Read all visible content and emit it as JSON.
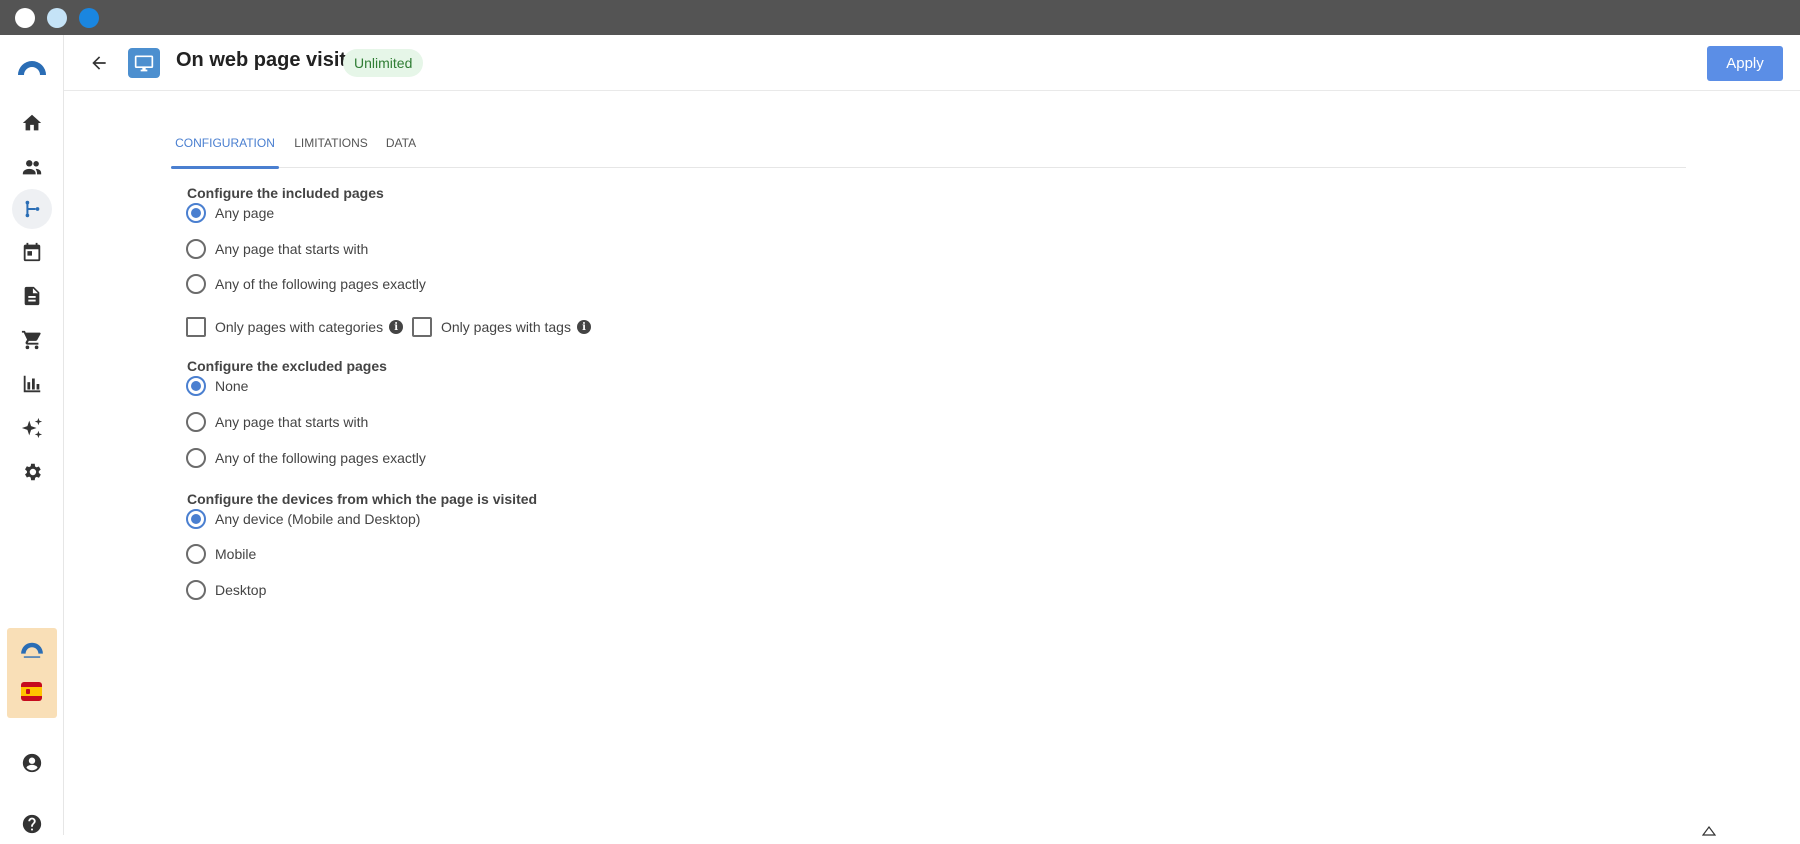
{
  "window": {
    "controls": [
      "close",
      "minimize",
      "maximize"
    ]
  },
  "colors": {
    "accent": "#4a7fd0",
    "apply_button": "#5b8ee6",
    "badge_bg": "#e6f6e8",
    "badge_text": "#2f7d34",
    "titlebar": "#545454",
    "brand_panel": "#f9dfb7"
  },
  "sidebar": {
    "items": [
      {
        "icon": "logo-icon"
      },
      {
        "icon": "home-icon"
      },
      {
        "icon": "people-icon"
      },
      {
        "icon": "workflow-icon",
        "active": true
      },
      {
        "icon": "calendar-icon"
      },
      {
        "icon": "document-icon"
      },
      {
        "icon": "cart-icon"
      },
      {
        "icon": "bar-chart-icon"
      },
      {
        "icon": "sparkle-icon"
      },
      {
        "icon": "gear-icon"
      },
      {
        "icon": "account-icon"
      },
      {
        "icon": "help-icon"
      }
    ]
  },
  "header": {
    "title": "On web page visit",
    "badge": "Unlimited",
    "apply_label": "Apply"
  },
  "tabs": [
    {
      "label": "CONFIGURATION",
      "active": true
    },
    {
      "label": "LIMITATIONS",
      "active": false
    },
    {
      "label": "DATA",
      "active": false
    }
  ],
  "included": {
    "title": "Configure the included pages",
    "options": [
      {
        "label": "Any page",
        "selected": true
      },
      {
        "label": "Any page that starts with",
        "selected": false
      },
      {
        "label": "Any of the following pages exactly",
        "selected": false
      }
    ],
    "filters": [
      {
        "label": "Only pages with categories",
        "checked": false
      },
      {
        "label": "Only pages with tags",
        "checked": false
      }
    ]
  },
  "excluded": {
    "title": "Configure the excluded pages",
    "options": [
      {
        "label": "None",
        "selected": true
      },
      {
        "label": "Any page that starts with",
        "selected": false
      },
      {
        "label": "Any of the following pages exactly",
        "selected": false
      }
    ]
  },
  "devices": {
    "title": "Configure the devices from which the page is visited",
    "options": [
      {
        "label": "Any device (Mobile and Desktop)",
        "selected": true
      },
      {
        "label": "Mobile",
        "selected": false
      },
      {
        "label": "Desktop",
        "selected": false
      }
    ]
  }
}
